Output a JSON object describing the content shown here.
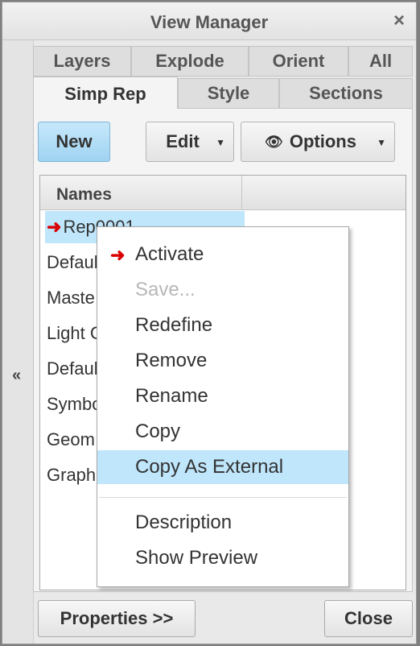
{
  "window": {
    "title": "View Manager",
    "close_glyph": "×",
    "collapse_glyph": "«"
  },
  "tabs_row1": [
    "Layers",
    "Explode",
    "Orient",
    "All"
  ],
  "tabs_row2": [
    "Simp Rep",
    "Style",
    "Sections"
  ],
  "toolbar": {
    "new_label": "New",
    "edit_label": "Edit",
    "options_label": "Options",
    "caret": "▼",
    "eye_glyph": "👁"
  },
  "list": {
    "header": "Names",
    "rows": [
      "Rep0001",
      "Defaul",
      "Maste",
      "Light C",
      "Defaul",
      "Symbo",
      "Geom",
      "Graph"
    ]
  },
  "context_menu": {
    "items": [
      "Activate",
      "Save...",
      "Redefine",
      "Remove",
      "Rename",
      "Copy",
      "Copy As External",
      "Description",
      "Show Preview"
    ],
    "hovered": "Copy As External",
    "disabled": "Save..."
  },
  "footer": {
    "properties_label": "Properties >>",
    "close_label": "Close"
  },
  "colors": {
    "selection": "#bfe6fb",
    "new_button": "#9fd3f2",
    "active_arrow": "#d90000"
  }
}
